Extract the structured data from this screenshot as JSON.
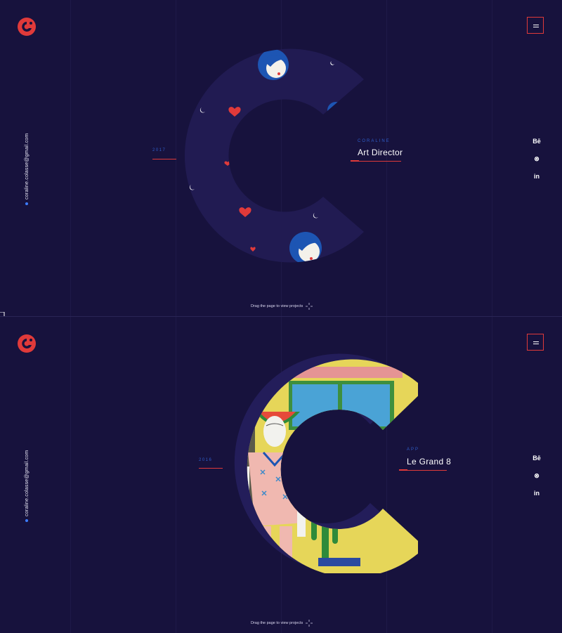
{
  "colors": {
    "background": "#17123d",
    "accent_red": "#e03a3a",
    "accent_blue": "#2f5ec9",
    "c_shape_fill": "#1f1a4d"
  },
  "contact": {
    "email": "coraline.colasse@gmail.com"
  },
  "social": [
    {
      "icon": "behance-icon",
      "label": "Bē"
    },
    {
      "icon": "dribbble-icon",
      "label": "⊗"
    },
    {
      "icon": "linkedin-icon",
      "label": "in"
    }
  ],
  "hero": {
    "year": "2017",
    "category": "CORALINE",
    "title": "Art Director"
  },
  "project": {
    "year": "2016",
    "category": "APP",
    "title": "Le Grand 8"
  },
  "drag_hint": "Drag the page to view projects"
}
